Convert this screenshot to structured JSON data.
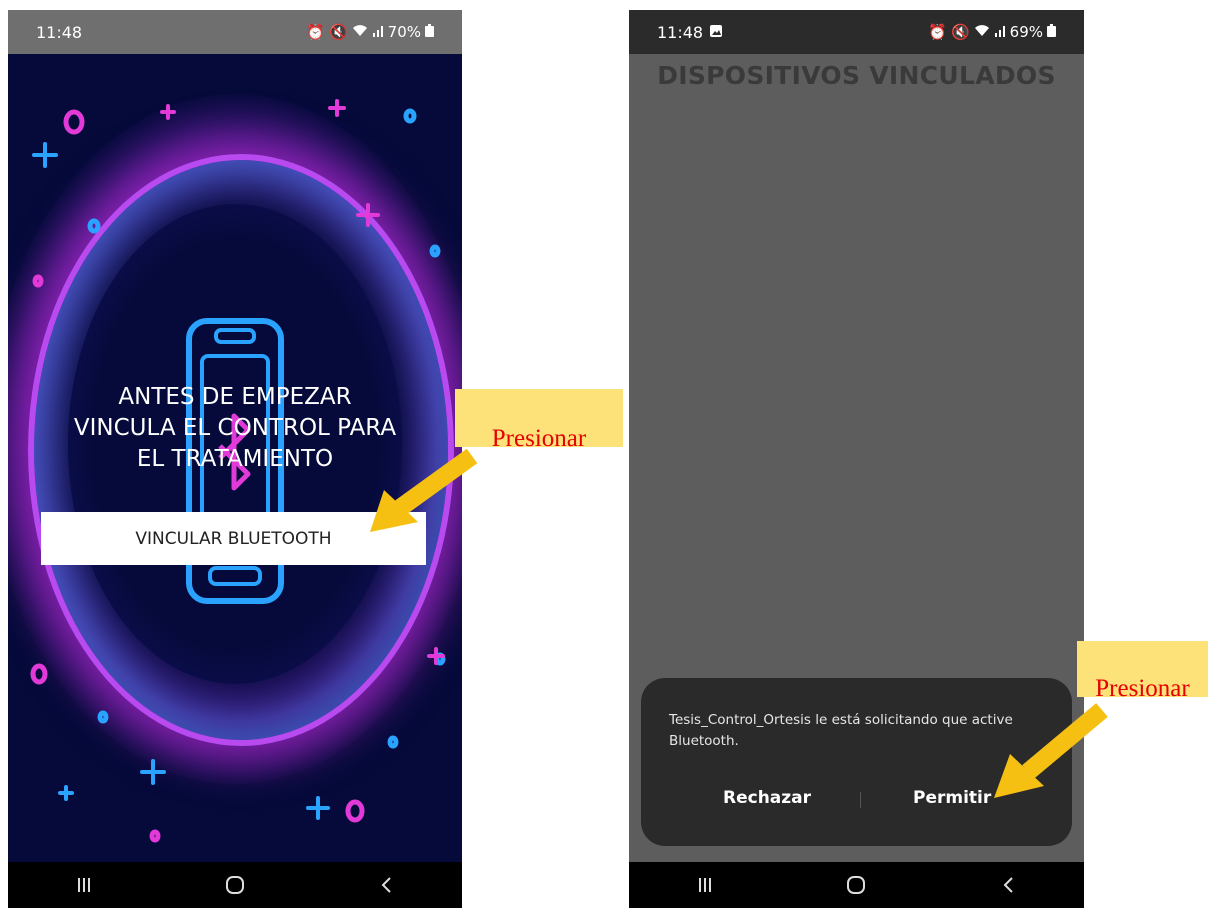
{
  "screen1": {
    "status": {
      "time": "11:48",
      "battery": "70%"
    },
    "intro_text_line1": "ANTES DE EMPEZAR",
    "intro_text_line2": "VINCULA EL CONTROL PARA",
    "intro_text_line3": "EL TRATAMIENTO",
    "button_label": "VINCULAR BLUETOOTH"
  },
  "screen2": {
    "status": {
      "time": "11:48",
      "battery": "69%"
    },
    "title": "DISPOSITIVOS VINCULADOS",
    "dialog": {
      "message": "Tesis_Control_Ortesis le está solicitando que active Bluetooth.",
      "reject_label": "Rechazar",
      "allow_label": "Permitir"
    }
  },
  "annotations": {
    "callout1": "Presionar",
    "callout2": "Presionar",
    "arrow_color": "#f6c013"
  },
  "icons": [
    "alarm-icon",
    "mute-icon",
    "wifi-icon",
    "signal-icon",
    "battery-icon",
    "gallery-icon",
    "recents-icon",
    "home-icon",
    "back-icon",
    "bluetooth-phone-icon"
  ]
}
